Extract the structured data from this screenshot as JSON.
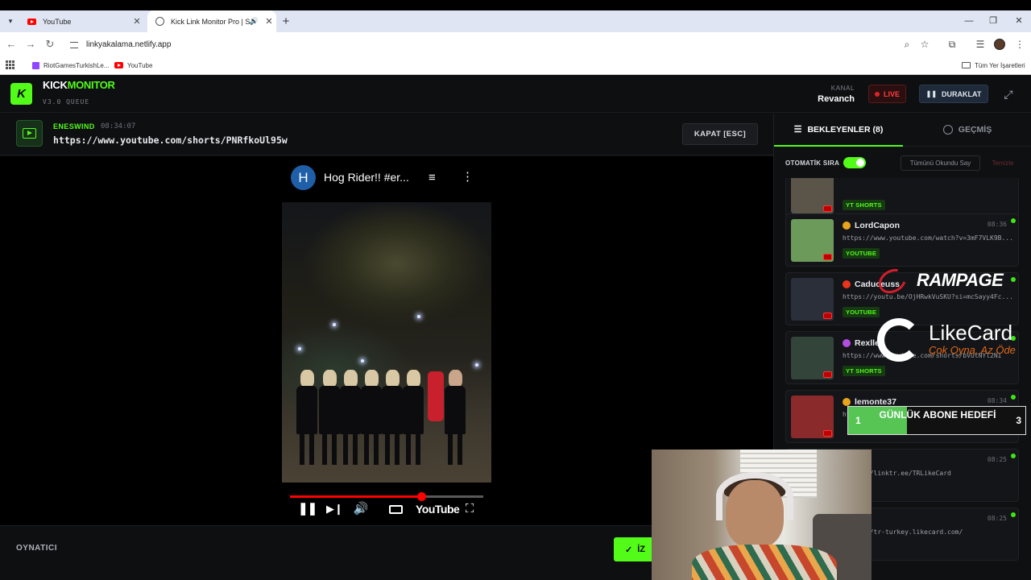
{
  "browser": {
    "tabs": [
      {
        "title": "YouTube",
        "active": false
      },
      {
        "title": "Kick Link Monitor Pro | Stre",
        "active": true
      }
    ],
    "url": "linkyakalama.netlify.app",
    "bookmarks": [
      "RiotGamesTurkishLe...",
      "YouTube"
    ],
    "bookmarks_folder": "Tüm Yer İşaretleri"
  },
  "app": {
    "brand_part1": "KICK",
    "brand_part2": "MONITOR",
    "logo_letter": "K",
    "version": "V3.0 QUEUE",
    "channel_label": "KANAL",
    "channel_name": "Revanch",
    "live_label": "LIVE",
    "pause_label": "DURAKLAT",
    "accent": "#53fc18"
  },
  "player": {
    "sender": "ENESWIND",
    "time": "08:34:07",
    "url": "https://www.youtube.com/shorts/PNRfkoUl95w",
    "close_label": "KAPAT [ESC]",
    "footer_label": "OYNATICI",
    "action_label": "İZ",
    "embed": {
      "channel_initial": "H",
      "title": "Hog Rider!! #er...",
      "brand": "YouTube",
      "progress": 0.68
    }
  },
  "sidebar": {
    "tab_waiting": "BEKLEYENLER (8)",
    "tab_history": "GEÇMİŞ",
    "auto_queue_label": "OTOMATİK SIRA",
    "auto_queue_on": true,
    "mark_all_read": "Tümünü Okundu Say",
    "clear": "Temizle",
    "queue": [
      {
        "user": "",
        "time": "",
        "url": "",
        "tag": "YT SHORTS",
        "badge_color": "",
        "thumb": "#5a5548",
        "partial": true
      },
      {
        "user": "LordCapon",
        "time": "08:36",
        "url": "https://www.youtube.com/watch?v=3mF7VLK9B...",
        "tag": "YOUTUBE",
        "badge_color": "#e8a41c",
        "thumb": "#6b9a5a"
      },
      {
        "user": "Caduceuss",
        "time": "",
        "url": "https://youtu.be/OjHRwkVuSKU?si=mcSayy4Fc...",
        "tag": "YOUTUBE",
        "badge_color": "#e8351c",
        "thumb": "#2b2f3a"
      },
      {
        "user": "Rexlle",
        "time": "",
        "url": "https://www.youtube.com/shorts/bVUtNYl2NI",
        "tag": "YT SHORTS",
        "badge_color": "#b24fe0",
        "thumb": "#33443a"
      },
      {
        "user": "lemonte37",
        "time": "08:34",
        "url": "https://youtu.be/...sB9n0MA",
        "tag": "",
        "badge_color": "#e8a41c",
        "thumb": "#8a2a2a"
      },
      {
        "user": "...ix",
        "time": "08:25",
        "url": "https://linktr.ee/TRLikeCard",
        "tag": "",
        "badge_color": "",
        "thumb": "#222"
      },
      {
        "user": "...ix",
        "time": "08:25",
        "url": "https://tr-turkey.likecard.com/",
        "tag": "",
        "badge_color": "",
        "thumb": "#222"
      }
    ]
  },
  "overlays": {
    "rampage": "RAMPAGE",
    "likecard_name": "LikeCard",
    "likecard_slogan": "Çok Oyna, Az Öde",
    "sub_goal_title": "GÜNLÜK ABONE HEDEFİ",
    "sub_goal_min": "1",
    "sub_goal_max": "3",
    "sub_goal_progress": 0.33
  }
}
